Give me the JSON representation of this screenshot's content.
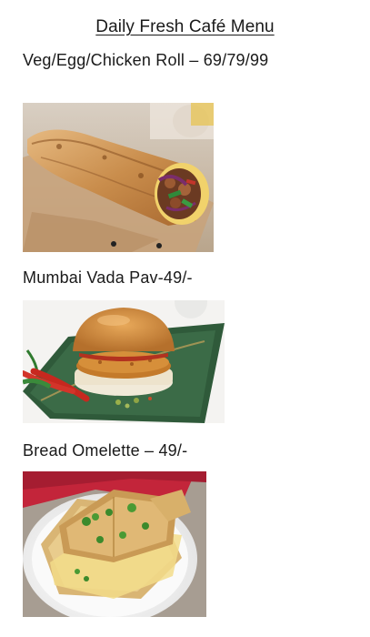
{
  "menu": {
    "title": "Daily Fresh Café Menu",
    "items": [
      {
        "label": "Veg/Egg/Chicken Roll – 69/79/99",
        "image": "chicken-roll-photo"
      },
      {
        "label": "Mumbai Vada Pav-49/-",
        "image": "vada-pav-photo"
      },
      {
        "label": "Bread Omelette – 49/-",
        "image": "bread-omelette-photo"
      }
    ]
  }
}
